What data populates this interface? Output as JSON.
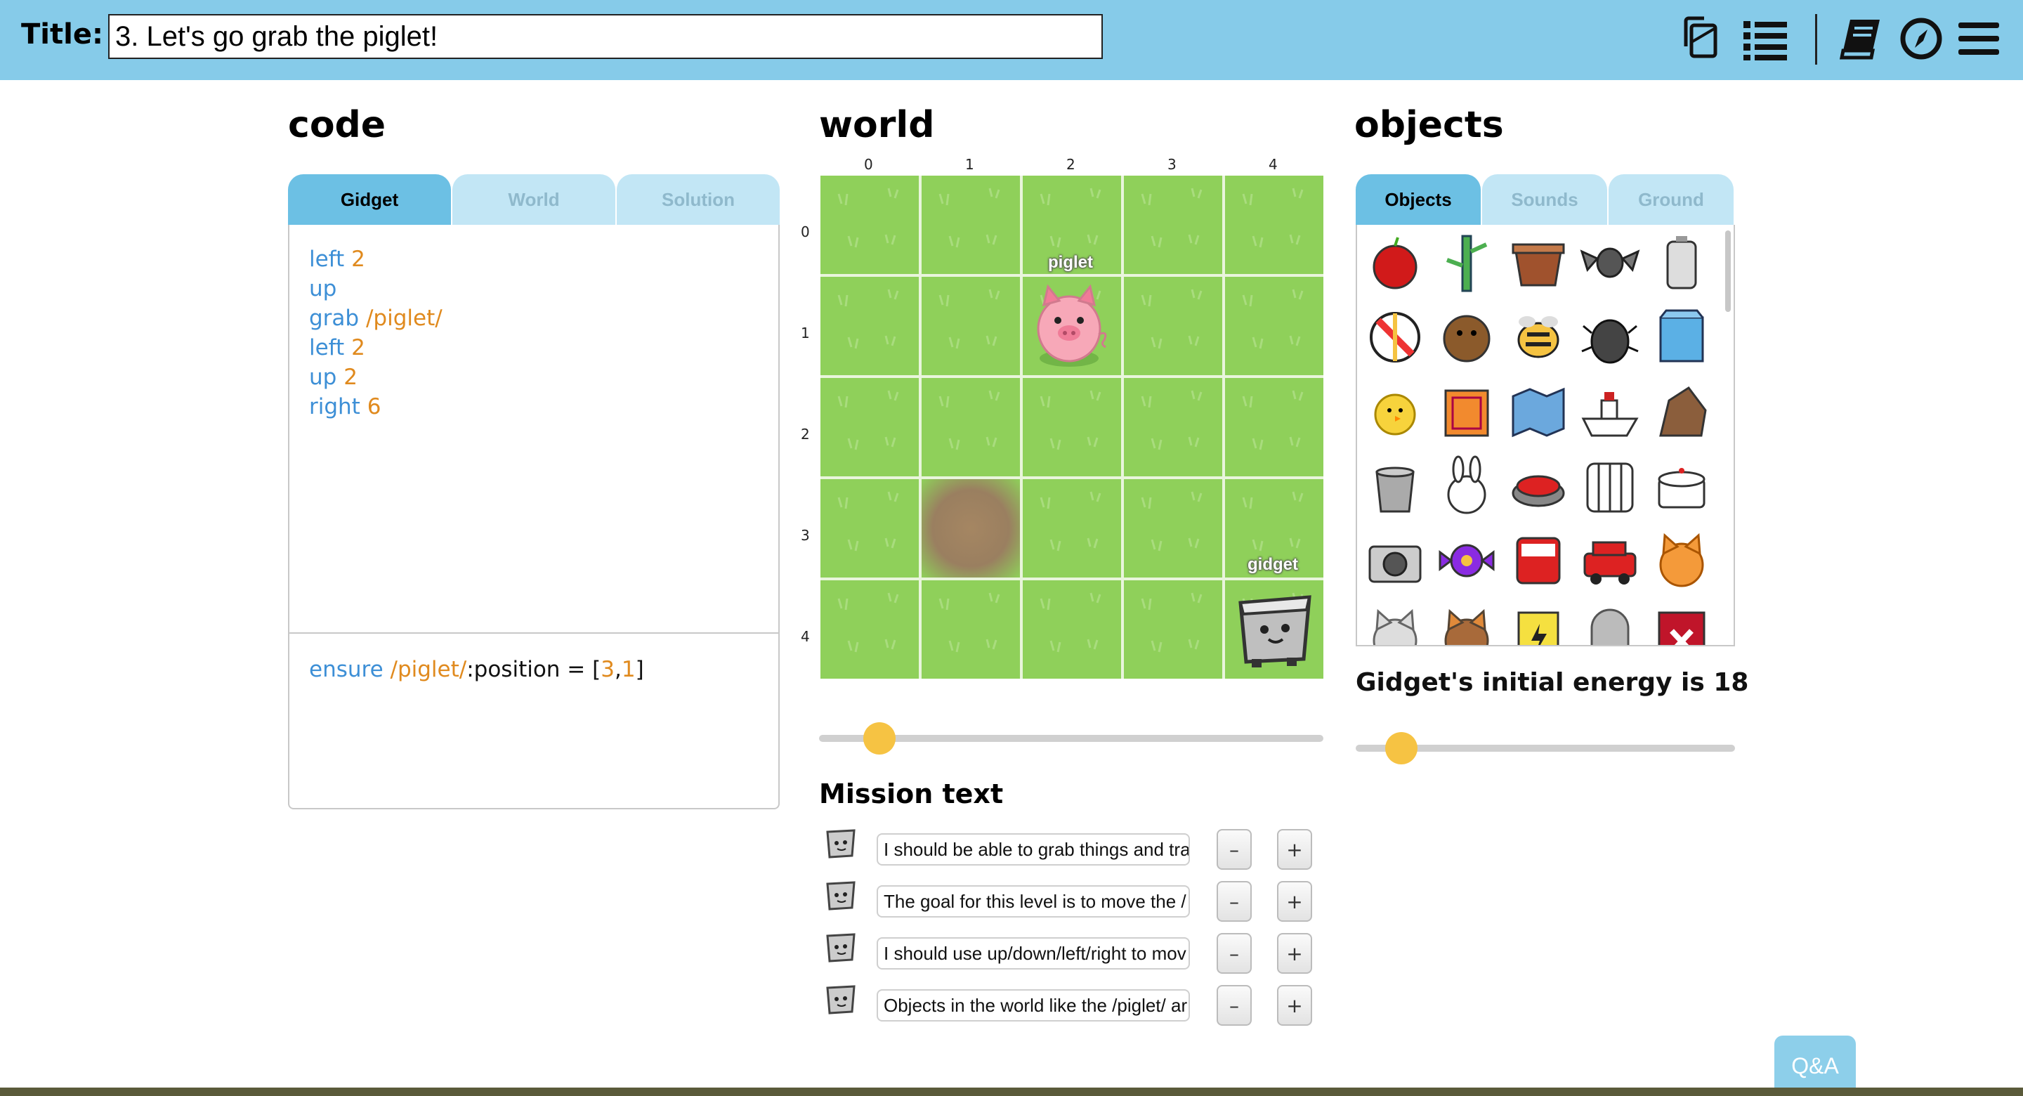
{
  "header": {
    "title_label": "Title:",
    "title_value": "3. Let's go grab the piglet!",
    "icons": [
      "copy-icon",
      "list-icon",
      "book-icon",
      "compass-icon",
      "menu-icon"
    ]
  },
  "code": {
    "heading": "code",
    "tabs": [
      {
        "label": "Gidget",
        "active": true
      },
      {
        "label": "World",
        "active": false
      },
      {
        "label": "Solution",
        "active": false
      }
    ],
    "lines": [
      {
        "cmd": "left",
        "arg": "2"
      },
      {
        "cmd": "up",
        "arg": ""
      },
      {
        "cmd": "grab",
        "arg": "/piglet/"
      },
      {
        "cmd": "left",
        "arg": "2"
      },
      {
        "cmd": "up",
        "arg": "2"
      },
      {
        "cmd": "right",
        "arg": "6"
      }
    ],
    "ensure": {
      "keyword": "ensure",
      "target": "/piglet/",
      "property": ":position = [",
      "x": "3",
      "comma": ",",
      "y": "1",
      "close": "]"
    }
  },
  "world": {
    "heading": "world",
    "columns": [
      "0",
      "1",
      "2",
      "3",
      "4"
    ],
    "rows": [
      "0",
      "1",
      "2",
      "3",
      "4"
    ],
    "objects": [
      {
        "label": "piglet",
        "col": 2,
        "row": 1
      },
      {
        "label": "gidget",
        "col": 4,
        "row": 4
      }
    ],
    "dirt_cell": {
      "col": 1,
      "row": 3
    },
    "timeline_slider_value": 0.12
  },
  "mission": {
    "heading": "Mission text",
    "items": [
      "I should be able to grab things and tra",
      "The goal for this level is to move the /",
      "I should use up/down/left/right to mov",
      "Objects in the world like the /piglet/ ar"
    ],
    "minus_label": "–",
    "plus_label": "+"
  },
  "objects": {
    "heading": "objects",
    "tabs": [
      {
        "label": "Objects",
        "active": true
      },
      {
        "label": "Sounds",
        "active": false
      },
      {
        "label": "Ground",
        "active": false
      }
    ],
    "palette": [
      "apple-icon",
      "bamboo-icon",
      "basket-icon",
      "bat-icon",
      "battery-icon",
      "beachball-icon",
      "beaver-icon",
      "bee-icon",
      "beetle-icon",
      "blue-box-icon",
      "chick-icon",
      "orange-box-icon",
      "map-icon",
      "boat-icon",
      "rock-icon",
      "bucket-icon",
      "bunny-icon",
      "button-icon",
      "cage-icon",
      "cake-icon",
      "camera-icon",
      "candy-icon",
      "red-bus-icon",
      "red-car-icon",
      "orange-cat-icon",
      "gray-cat-icon",
      "brown-cat-icon",
      "charger-icon",
      "tombstone-icon",
      "red-x-icon"
    ]
  },
  "energy": {
    "text": "Gidget's initial energy is 18",
    "slider_value": 0.12
  },
  "qa_label": "Q&A",
  "colors": {
    "header_bg": "#86cbe9",
    "tab_active": "#6cc0e4",
    "tab_inactive": "#c2e6f5",
    "keyword": "#3d8fd6",
    "number": "#e08a1e",
    "grass": "#8fd05a",
    "slider_knob": "#f6c343"
  }
}
